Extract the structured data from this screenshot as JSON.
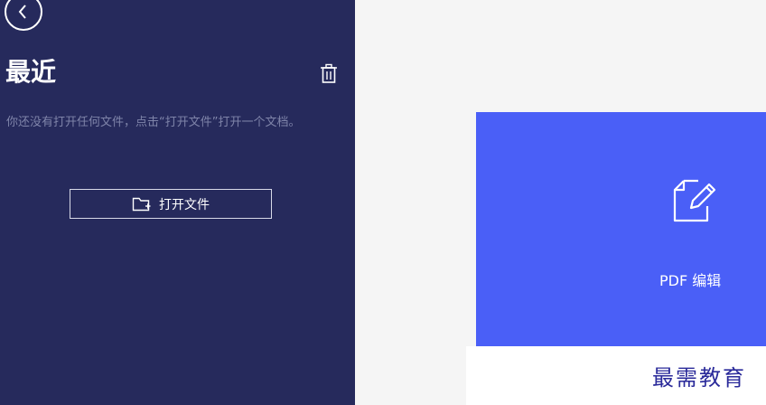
{
  "sidebar": {
    "back_icon": "chevron-left-circle-icon",
    "title": "最近",
    "trash_icon": "trash-icon",
    "empty_message": "你还没有打开任何文件，点击“打开文件”打开一个文档。",
    "open_button": {
      "icon": "folder-add-icon",
      "label": "打开文件"
    }
  },
  "main": {
    "card": {
      "icon": "edit-document-icon",
      "label": "PDF 编辑"
    }
  },
  "watermark": "最需教育",
  "colors": {
    "sidebar_bg": "#262a5c",
    "card_bg": "#4a5ff7",
    "main_bg": "#f5f5f5",
    "muted_text": "#7f84a9",
    "watermark": "#2a2a9a"
  }
}
